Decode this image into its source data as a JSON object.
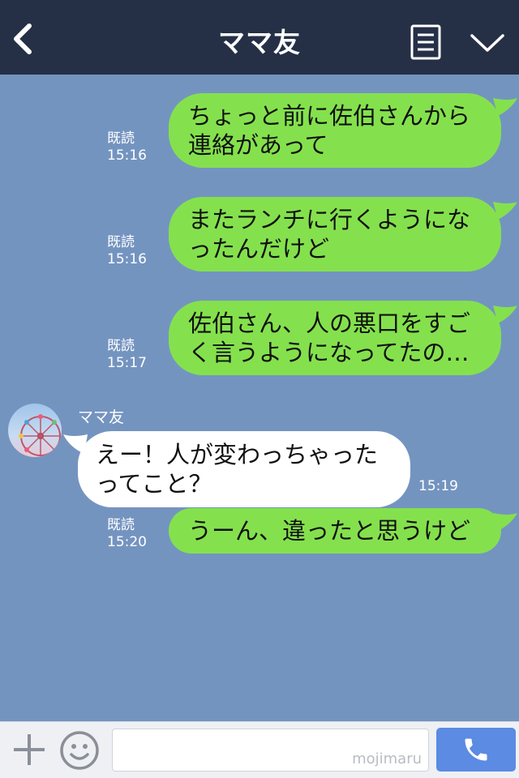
{
  "header": {
    "title": "ママ友",
    "background": "#253047"
  },
  "contact": {
    "name": "ママ友"
  },
  "messages": [
    {
      "direction": "out",
      "text": "ちょっと前に佐伯さんから連絡があって",
      "read": "既読",
      "time": "15:16"
    },
    {
      "direction": "out",
      "text": "またランチに行くようになったんだけど",
      "read": "既読",
      "time": "15:16"
    },
    {
      "direction": "out",
      "text": "佐伯さん、人の悪口をすごく言うようになってたの…",
      "read": "既読",
      "time": "15:17"
    },
    {
      "direction": "in",
      "text": "えー！人が変わっちゃったってこと？",
      "time": "15:19"
    },
    {
      "direction": "out",
      "text": "うーん、違ったと思うけど",
      "read": "既読",
      "time": "15:20"
    }
  ],
  "footer": {
    "watermark": "mojimaru"
  },
  "colors": {
    "chat_background": "#7494c0",
    "outgoing_bubble": "#84e14d",
    "incoming_bubble": "#ffffff",
    "call_button": "#5b8be3"
  },
  "icons": [
    "back-icon",
    "menu-icon",
    "chevron-down-icon",
    "plus-icon",
    "emoji-icon",
    "phone-icon"
  ]
}
